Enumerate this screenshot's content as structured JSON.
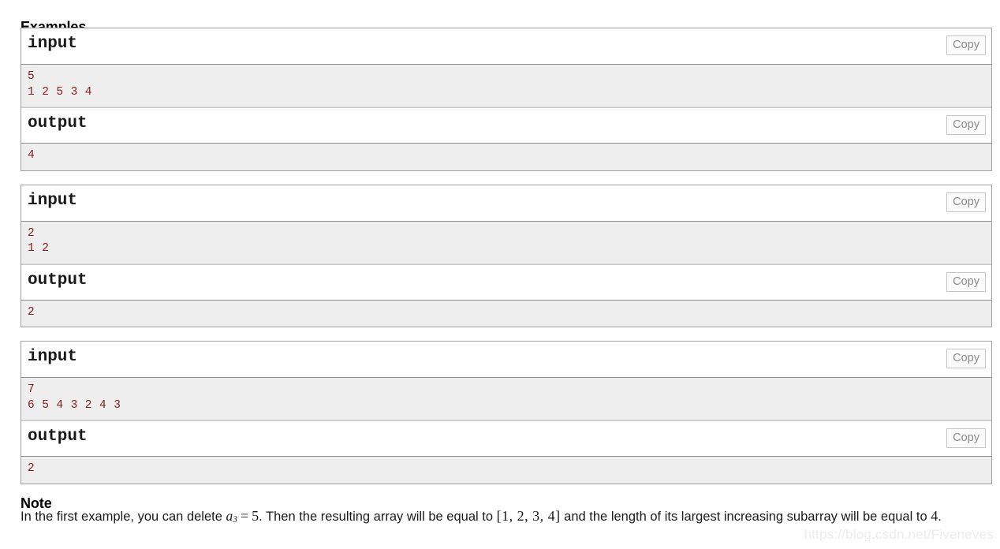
{
  "page": {
    "examples_heading": "Examples",
    "note_heading": "Note",
    "watermark": "https://blog.csdn.net/Fiveneves",
    "copy_label": "Copy",
    "input_label": "input",
    "output_label": "output",
    "colors": {
      "data_text": "#8b1a1a",
      "data_background": "#eeeeee",
      "border": "#a0a0a0",
      "copy_text": "#8a8a8a",
      "watermark": "#ececec"
    }
  },
  "examples": [
    {
      "input_label": "input",
      "output_label": "output",
      "copy_label": "Copy",
      "input_lines": [
        "5",
        "1 2 5 3 4"
      ],
      "output_lines": [
        "4"
      ]
    },
    {
      "input_label": "input",
      "output_label": "output",
      "copy_label": "Copy",
      "input_lines": [
        "2",
        "1 2"
      ],
      "output_lines": [
        "2"
      ]
    },
    {
      "input_label": "input",
      "output_label": "output",
      "copy_label": "Copy",
      "input_lines": [
        "7",
        "6 5 4 3 2 4 3"
      ],
      "output_lines": [
        "2"
      ]
    }
  ],
  "note": {
    "text_part1": "In the first example, you can delete ",
    "math_var": "a",
    "math_sub": "3",
    "math_eq": "=",
    "math_val": "5",
    "text_part2": ". Then the resulting array will be equal to ",
    "math_array": "[1, 2, 3, 4]",
    "text_part3": " and the length of its largest increasing subarray will be equal to ",
    "math_final": "4",
    "text_part4": "."
  }
}
